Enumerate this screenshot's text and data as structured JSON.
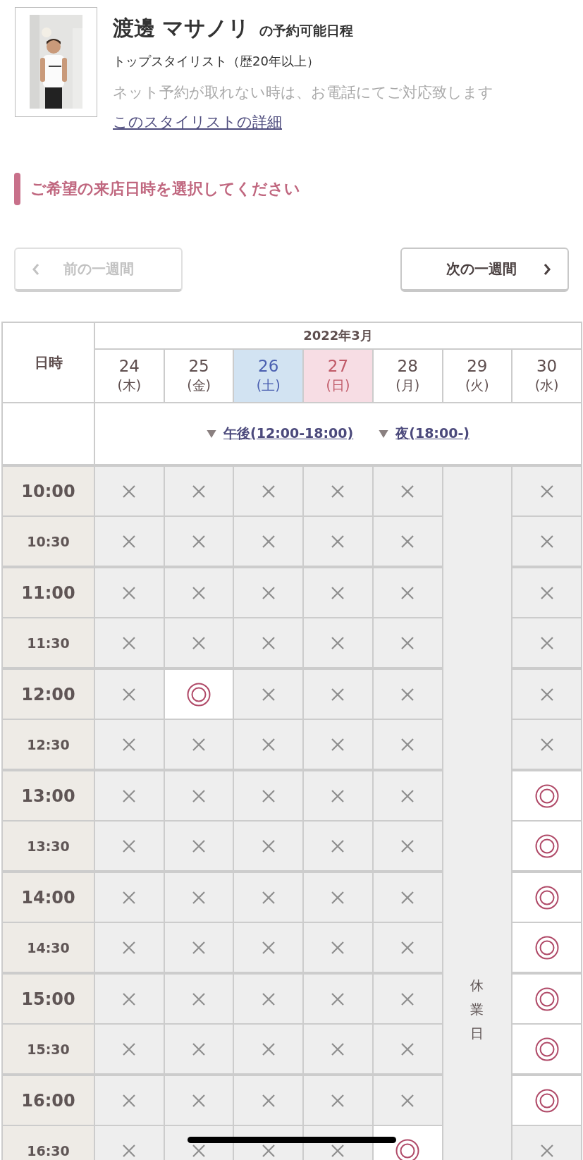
{
  "stylist": {
    "name": "渡邊 マサノリ",
    "suffix": "の予約可能日程",
    "title": "トップスタイリスト（歴20年以上）",
    "note": "ネット予約が取れない時は、お電話にてご対応致します",
    "link": "このスタイリストの詳細"
  },
  "heading": "ご希望の来店日時を選択してください",
  "nav": {
    "prev": {
      "label": "前の一週間",
      "disabled": true
    },
    "next": {
      "label": "次の一週間",
      "disabled": false
    }
  },
  "schedule": {
    "corner": "日時",
    "month": "2022年3月",
    "days": [
      {
        "date": "24",
        "weekday": "(木)",
        "kind": "weekday",
        "closed": false
      },
      {
        "date": "25",
        "weekday": "(金)",
        "kind": "weekday",
        "closed": false
      },
      {
        "date": "26",
        "weekday": "(土)",
        "kind": "saturday",
        "closed": false
      },
      {
        "date": "27",
        "weekday": "(日)",
        "kind": "sunday",
        "closed": false
      },
      {
        "date": "28",
        "weekday": "(月)",
        "kind": "weekday",
        "closed": false
      },
      {
        "date": "29",
        "weekday": "(火)",
        "kind": "weekday",
        "closed": true
      },
      {
        "date": "30",
        "weekday": "(水)",
        "kind": "weekday",
        "closed": false
      }
    ],
    "closed_label": "休業日",
    "periods": [
      {
        "label": "午後(12:00-18:00)"
      },
      {
        "label": "夜(18:00-)"
      }
    ],
    "rows": [
      {
        "time": "10:00",
        "major": true,
        "slots": [
          false,
          false,
          false,
          false,
          false,
          false
        ]
      },
      {
        "time": "10:30",
        "major": false,
        "slots": [
          false,
          false,
          false,
          false,
          false,
          false
        ]
      },
      {
        "time": "11:00",
        "major": true,
        "slots": [
          false,
          false,
          false,
          false,
          false,
          false
        ]
      },
      {
        "time": "11:30",
        "major": false,
        "slots": [
          false,
          false,
          false,
          false,
          false,
          false
        ]
      },
      {
        "time": "12:00",
        "major": true,
        "slots": [
          false,
          true,
          false,
          false,
          false,
          false
        ]
      },
      {
        "time": "12:30",
        "major": false,
        "slots": [
          false,
          false,
          false,
          false,
          false,
          false
        ]
      },
      {
        "time": "13:00",
        "major": true,
        "slots": [
          false,
          false,
          false,
          false,
          false,
          true
        ]
      },
      {
        "time": "13:30",
        "major": false,
        "slots": [
          false,
          false,
          false,
          false,
          false,
          true
        ]
      },
      {
        "time": "14:00",
        "major": true,
        "slots": [
          false,
          false,
          false,
          false,
          false,
          true
        ]
      },
      {
        "time": "14:30",
        "major": false,
        "slots": [
          false,
          false,
          false,
          false,
          false,
          true
        ]
      },
      {
        "time": "15:00",
        "major": true,
        "slots": [
          false,
          false,
          false,
          false,
          false,
          true
        ]
      },
      {
        "time": "15:30",
        "major": false,
        "slots": [
          false,
          false,
          false,
          false,
          false,
          true
        ]
      },
      {
        "time": "16:00",
        "major": true,
        "slots": [
          false,
          false,
          false,
          false,
          false,
          true
        ]
      },
      {
        "time": "16:30",
        "major": false,
        "slots": [
          false,
          false,
          false,
          false,
          true,
          false
        ]
      }
    ]
  }
}
